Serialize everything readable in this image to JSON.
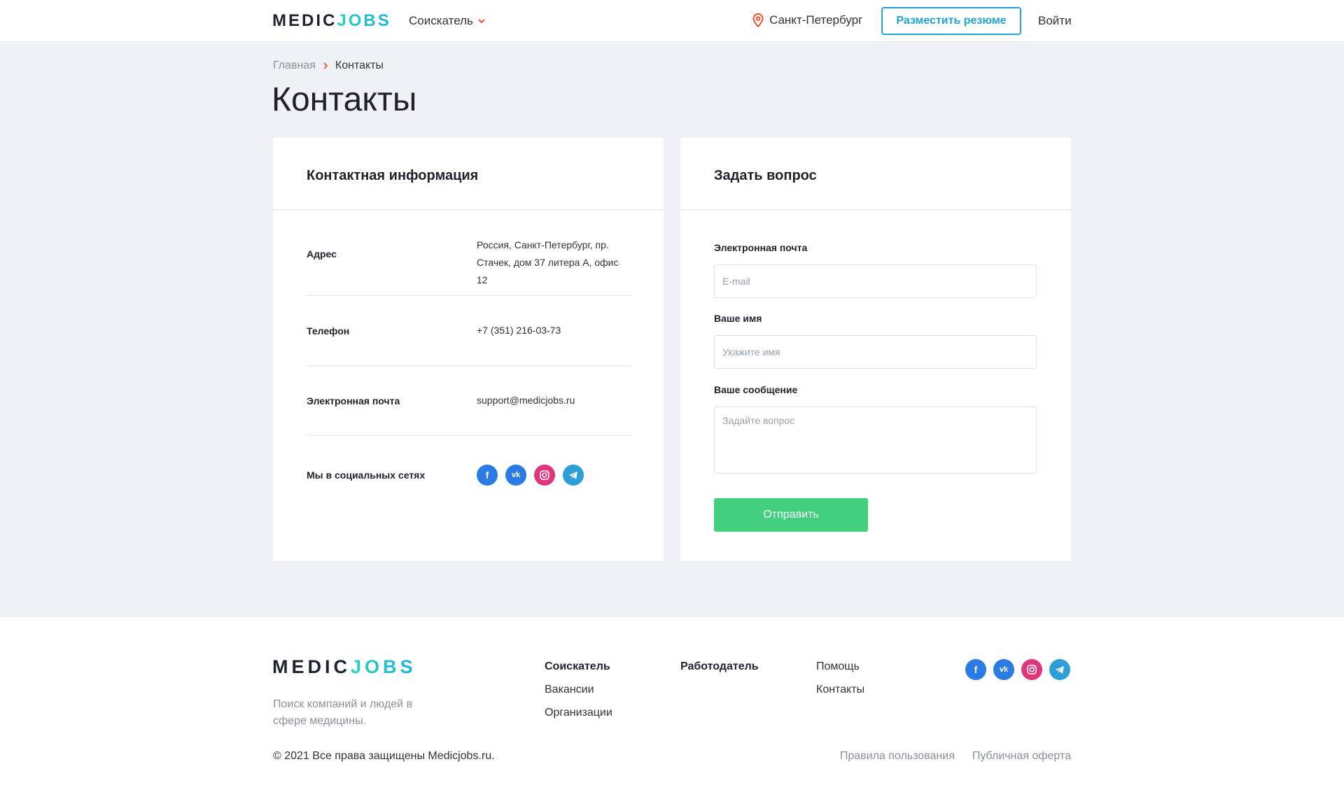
{
  "header": {
    "logo_part1": "MEDIC",
    "logo_part2": "JOBS",
    "role_label": "Соискатель",
    "city": "Санкт-Петербург",
    "post_resume_label": "Разместить резюме",
    "login_label": "Войти"
  },
  "breadcrumb": {
    "home": "Главная",
    "current": "Контакты"
  },
  "page_title": "Контакты",
  "contact_card": {
    "title": "Контактная информация",
    "address_label": "Адрес",
    "address_line1": "Россия, Санкт-Петербург, пр.",
    "address_line2": "Стачек, дом 37 литера А, офис 12",
    "phone_label": "Телефон",
    "phone_value": "+7 (351) 216-03-73",
    "email_label": "Электронная почта",
    "email_value": "support@medicjobs.ru",
    "social_label": "Мы в социальных сетях"
  },
  "question_card": {
    "title": "Задать вопрос",
    "email_label": "Электронная почта",
    "email_placeholder": "E-mail",
    "name_label": "Ваше имя",
    "name_placeholder": "Укажите имя",
    "message_label": "Ваше сообщение",
    "message_placeholder": "Задайте вопрос",
    "submit_label": "Отправить"
  },
  "footer": {
    "logo_part1": "MEDIC",
    "logo_part2": "JOBS",
    "tagline": "Поиск компаний и людей в сфере медицины.",
    "col1": {
      "head": "Соискатель",
      "items": [
        "Вакансии",
        "Организации"
      ]
    },
    "col2": {
      "head": "Работодатель"
    },
    "col3": {
      "items": [
        "Помощь",
        "Контакты"
      ]
    },
    "copyright": "© 2021 Все права защищены Medicjobs.ru.",
    "terms": "Правила пользования",
    "offer": "Публичная оферта"
  },
  "social_icons": [
    "facebook-icon",
    "vk-icon",
    "instagram-icon",
    "telegram-icon"
  ],
  "colors": {
    "accent_blue": "#1fa3d8",
    "accent_orange": "#e8542a",
    "submit_green": "#42d07d",
    "page_bg": "#eef1f5"
  }
}
